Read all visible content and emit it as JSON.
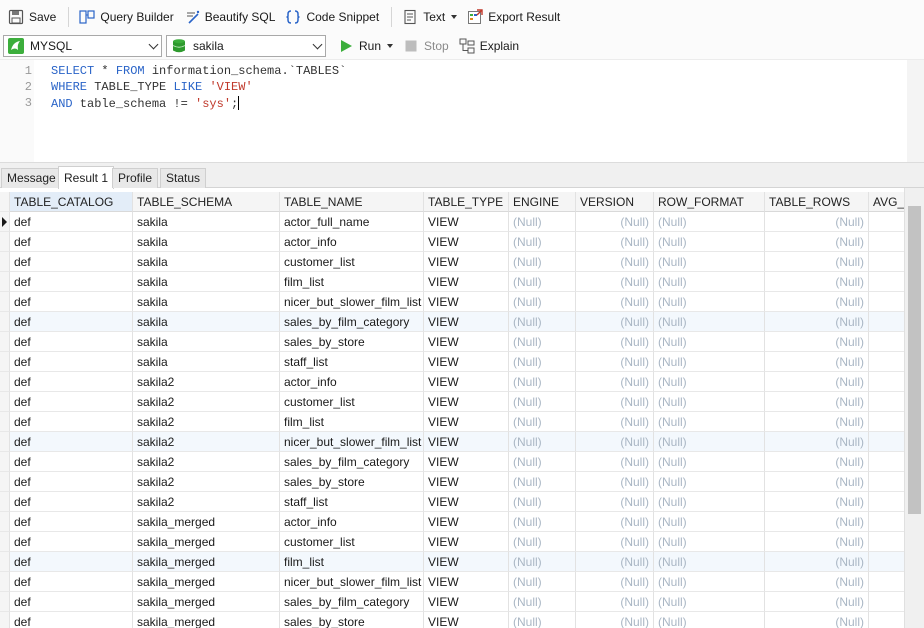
{
  "toolbar": {
    "save": "Save",
    "query_builder": "Query Builder",
    "beautify": "Beautify SQL",
    "code_snippet": "Code Snippet",
    "text": "Text",
    "export": "Export Result"
  },
  "connection": {
    "value": "MYSQL"
  },
  "database": {
    "value": "sakila"
  },
  "actions": {
    "run": "Run",
    "stop": "Stop",
    "explain": "Explain"
  },
  "editor": {
    "line_numbers": [
      "1",
      "2",
      "3"
    ],
    "line1": {
      "kw1": "SELECT",
      "mid1": " * ",
      "kw2": "FROM",
      "rest": " information_schema.`TABLES`"
    },
    "line2": {
      "kw1": "WHERE",
      "mid": " TABLE_TYPE ",
      "kw2": "LIKE",
      "sp": " ",
      "str": "'VIEW'"
    },
    "line3": {
      "kw1": "AND",
      "mid": " table_schema != ",
      "str": "'sys'",
      "end": ";"
    }
  },
  "tabs": [
    "Message",
    "Result 1",
    "Profile",
    "Status"
  ],
  "active_tab": "Result 1",
  "grid": {
    "columns": [
      "TABLE_CATALOG",
      "TABLE_SCHEMA",
      "TABLE_NAME",
      "TABLE_TYPE",
      "ENGINE",
      "VERSION",
      "ROW_FORMAT",
      "TABLE_ROWS",
      "AVG_R"
    ],
    "null_text": "(Null)",
    "rows": [
      [
        "def",
        "sakila",
        "actor_full_name",
        "VIEW"
      ],
      [
        "def",
        "sakila",
        "actor_info",
        "VIEW"
      ],
      [
        "def",
        "sakila",
        "customer_list",
        "VIEW"
      ],
      [
        "def",
        "sakila",
        "film_list",
        "VIEW"
      ],
      [
        "def",
        "sakila",
        "nicer_but_slower_film_list",
        "VIEW"
      ],
      [
        "def",
        "sakila",
        "sales_by_film_category",
        "VIEW"
      ],
      [
        "def",
        "sakila",
        "sales_by_store",
        "VIEW"
      ],
      [
        "def",
        "sakila",
        "staff_list",
        "VIEW"
      ],
      [
        "def",
        "sakila2",
        "actor_info",
        "VIEW"
      ],
      [
        "def",
        "sakila2",
        "customer_list",
        "VIEW"
      ],
      [
        "def",
        "sakila2",
        "film_list",
        "VIEW"
      ],
      [
        "def",
        "sakila2",
        "nicer_but_slower_film_list",
        "VIEW"
      ],
      [
        "def",
        "sakila2",
        "sales_by_film_category",
        "VIEW"
      ],
      [
        "def",
        "sakila2",
        "sales_by_store",
        "VIEW"
      ],
      [
        "def",
        "sakila2",
        "staff_list",
        "VIEW"
      ],
      [
        "def",
        "sakila_merged",
        "actor_info",
        "VIEW"
      ],
      [
        "def",
        "sakila_merged",
        "customer_list",
        "VIEW"
      ],
      [
        "def",
        "sakila_merged",
        "film_list",
        "VIEW"
      ],
      [
        "def",
        "sakila_merged",
        "nicer_but_slower_film_list",
        "VIEW"
      ],
      [
        "def",
        "sakila_merged",
        "sales_by_film_category",
        "VIEW"
      ],
      [
        "def",
        "sakila_merged",
        "sales_by_store",
        "VIEW"
      ]
    ]
  },
  "colors": {
    "accent_blue": "#2a64c8",
    "run_green": "#3cae3c",
    "string_red": "#c0392b",
    "null_gray": "#a9b6c4",
    "highlight_row": "#f3f8fd"
  }
}
